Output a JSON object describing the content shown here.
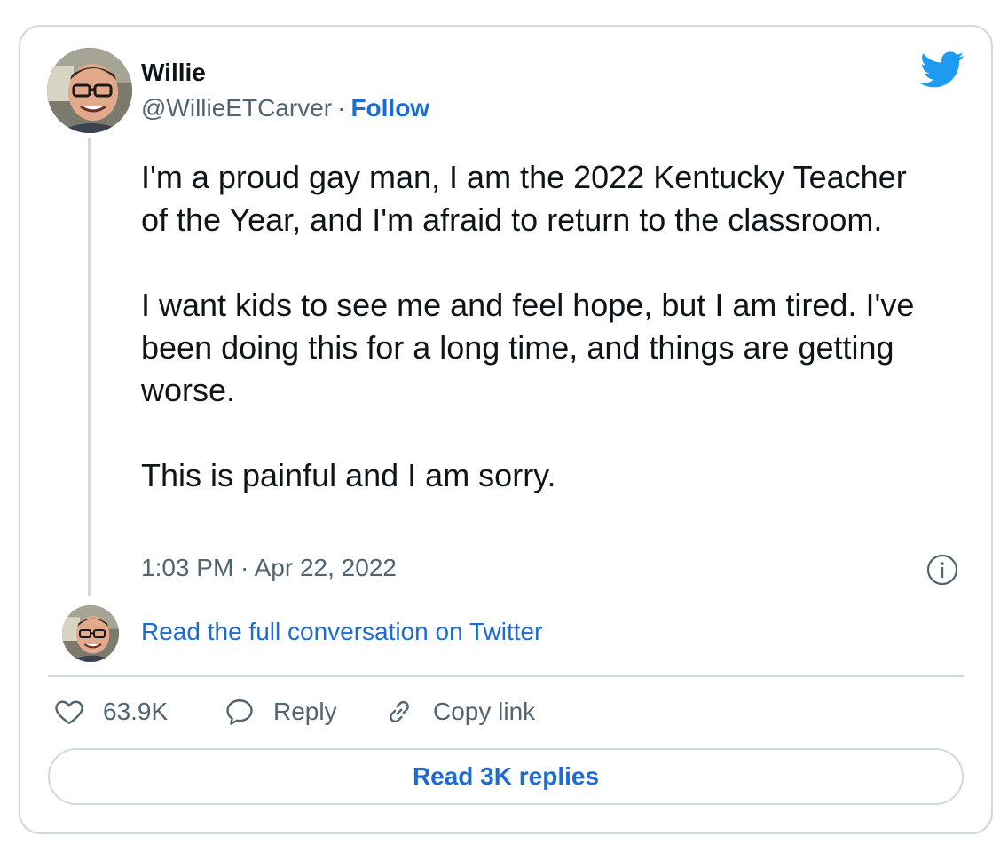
{
  "tweet": {
    "author_name": "Willie",
    "handle": "@WillieETCarver",
    "separator": "·",
    "follow_label": "Follow",
    "paragraphs": [
      "I'm a proud gay man, I am the 2022 Kentucky Teacher of the Year, and I'm afraid to return to the classroom.",
      "I want kids to see me and feel hope, but I am tired. I've been doing this for a long time, and things are getting worse.",
      "This is painful and I am sorry."
    ],
    "timestamp": "1:03 PM · Apr 22, 2022",
    "read_full_label": "Read the full conversation on Twitter"
  },
  "actions": {
    "like_count": "63.9K",
    "reply_label": "Reply",
    "copy_link_label": "Copy link"
  },
  "footer": {
    "read_replies_label": "Read 3K replies"
  },
  "icons": {
    "logo": "twitter-bird-icon",
    "info": "info-icon",
    "like": "heart-icon",
    "reply": "speech-bubble-icon",
    "copy": "link-icon"
  },
  "colors": {
    "link_blue": "#1d6bd6",
    "twitter_blue": "#1d9bf0",
    "muted_text": "#536471",
    "border": "#cfd9de",
    "text": "#0f1419"
  }
}
